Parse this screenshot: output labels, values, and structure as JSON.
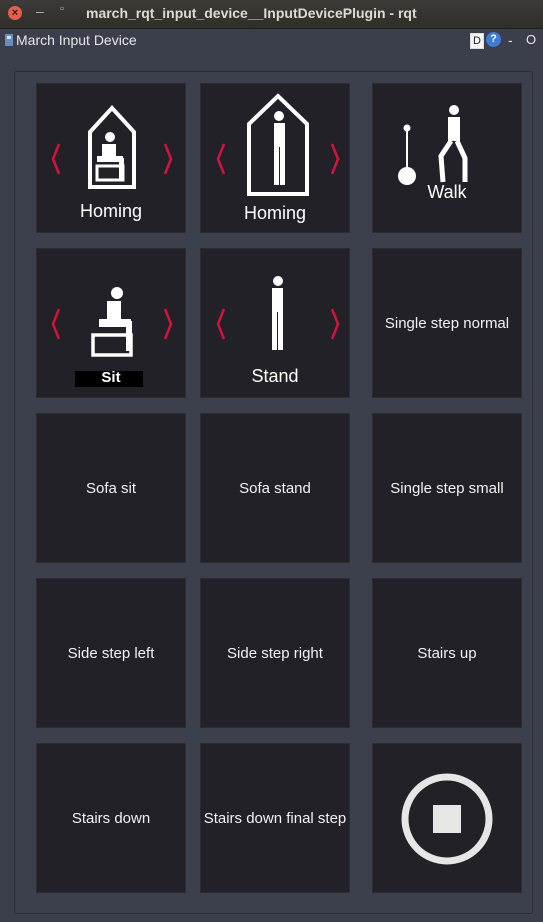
{
  "window": {
    "title": "march_rqt_input_device__InputDevicePlugin - rqt"
  },
  "plugin": {
    "title": "March Input Device",
    "d_label": "D",
    "help_label": "?",
    "minimize_label": "-",
    "close_label": "O"
  },
  "buttons": [
    {
      "label": "Homing",
      "icon": "homing-sit-icon"
    },
    {
      "label": "Homing",
      "icon": "homing-stand-icon"
    },
    {
      "label": "Walk",
      "icon": "walk-icon"
    },
    {
      "label": "Sit",
      "icon": "sit-icon"
    },
    {
      "label": "Stand",
      "icon": "stand-icon"
    },
    {
      "label": "Single step normal"
    },
    {
      "label": "Sofa sit"
    },
    {
      "label": "Sofa stand"
    },
    {
      "label": "Single step small"
    },
    {
      "label": "Side step left"
    },
    {
      "label": "Side step right"
    },
    {
      "label": "Stairs up"
    },
    {
      "label": "Stairs down"
    },
    {
      "label": "Stairs down final step"
    },
    {
      "label": "",
      "icon": "stop-icon"
    }
  ],
  "colors": {
    "arrow": "#d4143c",
    "tile": "#222127",
    "panel": "#3b404c"
  }
}
